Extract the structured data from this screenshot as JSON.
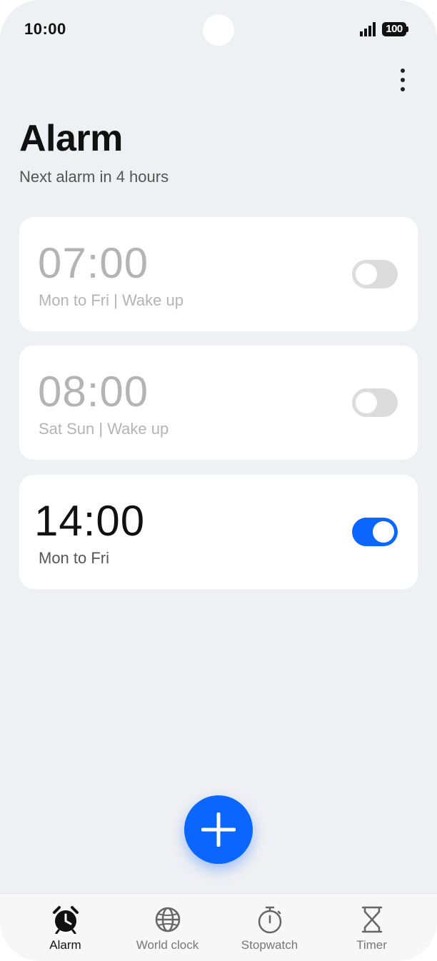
{
  "status_bar": {
    "time": "10:00",
    "battery": "100"
  },
  "header": {
    "title": "Alarm",
    "subtitle": "Next alarm in 4 hours"
  },
  "alarms": [
    {
      "time": "07:00",
      "desc": "Mon to Fri | Wake up",
      "enabled": false
    },
    {
      "time": "08:00",
      "desc": "Sat Sun | Wake up",
      "enabled": false
    },
    {
      "time": "14:00",
      "desc": "Mon to Fri",
      "enabled": true
    }
  ],
  "nav": [
    {
      "label": "Alarm",
      "icon": "alarm-clock-icon",
      "active": true
    },
    {
      "label": "World clock",
      "icon": "globe-icon",
      "active": false
    },
    {
      "label": "Stopwatch",
      "icon": "stopwatch-icon",
      "active": false
    },
    {
      "label": "Timer",
      "icon": "hourglass-icon",
      "active": false
    }
  ],
  "colors": {
    "accent": "#0a66ff",
    "background": "#eff0f3",
    "inactive_text": "#b4b4b4"
  }
}
